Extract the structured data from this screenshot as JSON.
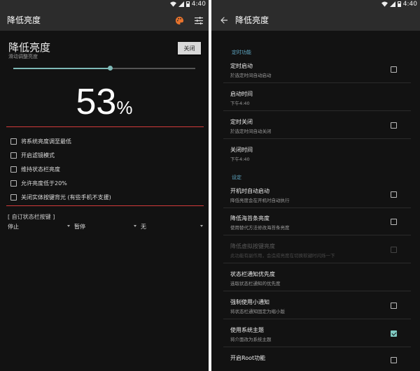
{
  "status": {
    "time": "4:40"
  },
  "left": {
    "appbar": {
      "title": "降低亮度",
      "palette_icon": "palette-icon",
      "tune_icon": "tune-icon"
    },
    "brightness": {
      "title": "降低亮度",
      "subtitle": "滑动调整亮度",
      "off_label": "关闭",
      "value": 53,
      "value_text": "53",
      "unit": "%",
      "slider_fraction": 0.53
    },
    "options": [
      {
        "label": "将系统亮度调至最低",
        "checked": false
      },
      {
        "label": "开启滤镜模式",
        "checked": false
      },
      {
        "label": "维持状态栏亮度",
        "checked": false
      },
      {
        "label": "允许亮度低于20%",
        "checked": false
      },
      {
        "label": "关闭实体按键背光 (有些手机不支援)",
        "checked": false
      }
    ],
    "custom": {
      "title": "[ 自订状态栏按键 ]",
      "spinners": [
        {
          "value": "停止"
        },
        {
          "value": "暂停"
        },
        {
          "value": "无"
        }
      ]
    },
    "accent_red": "#d23a3a",
    "accent_teal": "#7fb9b7"
  },
  "right": {
    "appbar": {
      "title": "降低亮度",
      "back_icon": "back-arrow-icon"
    },
    "sections": {
      "timer": "定时功能",
      "settings": "设定"
    },
    "prefs": [
      {
        "title": "定时启动",
        "summary": "於选定时间自动启动",
        "checkbox": true,
        "checked": false,
        "disabled": false
      },
      {
        "title": "启动时间",
        "summary": "下午4:40",
        "checkbox": false,
        "checked": false,
        "disabled": false
      },
      {
        "title": "定时关闭",
        "summary": "於选定时间自动关闭",
        "checkbox": true,
        "checked": false,
        "disabled": false
      },
      {
        "title": "关闭时间",
        "summary": "下午4:40",
        "checkbox": false,
        "checked": false,
        "disabled": false
      },
      {
        "title": "开机时自动启动",
        "summary": "降低亮度会在开机时自动执行",
        "checkbox": true,
        "checked": false,
        "disabled": false
      },
      {
        "title": "降低海苔条亮度",
        "summary": "使用替代方法修改海苔条亮度",
        "checkbox": true,
        "checked": false,
        "disabled": false
      },
      {
        "title": "降低虚拟按键亮度",
        "summary": "此功能有副作用，会造成亮度在切换软键时闪烁一下",
        "checkbox": true,
        "checked": false,
        "disabled": true
      },
      {
        "title": "状态栏通知优先度",
        "summary": "选取状态栏通知的优先度",
        "checkbox": false,
        "checked": false,
        "disabled": false
      },
      {
        "title": "强制使用小通知",
        "summary": "将状态栏通知固定为缩小版",
        "checkbox": true,
        "checked": false,
        "disabled": false
      },
      {
        "title": "使用系统主题",
        "summary": "将介面改为系统主题",
        "checkbox": true,
        "checked": true,
        "disabled": false
      },
      {
        "title": "开启Root功能",
        "summary": "",
        "checkbox": true,
        "checked": false,
        "disabled": false
      }
    ],
    "accent_section": "#5fa8c4",
    "accent_check": "#7fc9c1"
  }
}
